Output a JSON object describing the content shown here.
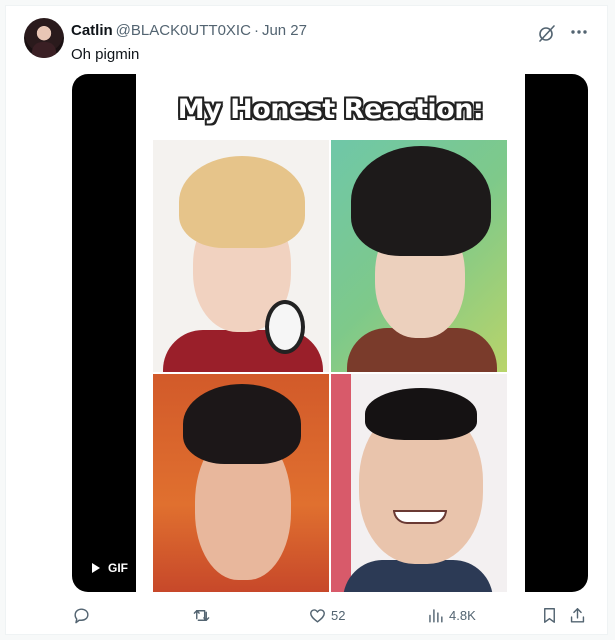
{
  "tweet": {
    "author_name": "Catlin",
    "author_handle": "@BLACK0UTT0XIC",
    "separator": "·",
    "date": "Jun 27",
    "text": "Oh pigmin"
  },
  "media": {
    "title": "My Honest Reaction:",
    "badge": "GIF"
  },
  "actions": {
    "reply_count": "",
    "retweet_count": "",
    "like_count": "52",
    "views_count": "4.8K"
  },
  "icons": {
    "grok": "grok-icon",
    "more": "more-icon",
    "play": "play-icon",
    "reply": "reply-icon",
    "retweet": "retweet-icon",
    "like": "heart-icon",
    "views": "views-icon",
    "bookmark": "bookmark-icon",
    "share": "share-icon"
  },
  "colors": {
    "muted": "#536471",
    "text": "#0f1419",
    "border": "#eff3f4"
  }
}
